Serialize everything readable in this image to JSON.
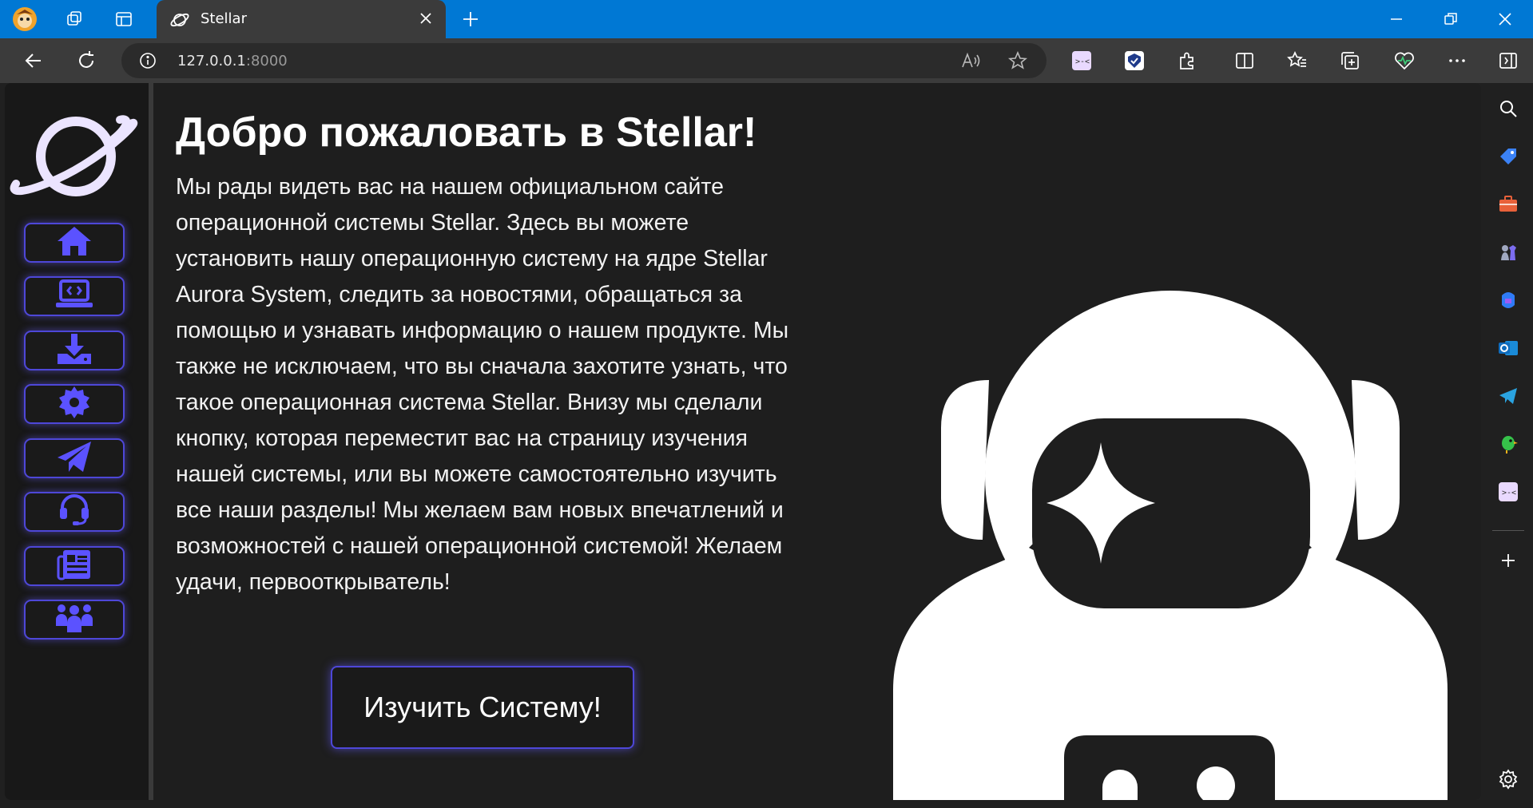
{
  "browser": {
    "tab": {
      "title": "Stellar"
    },
    "address": {
      "host": "127.0.0.1",
      "port": ":8000"
    }
  },
  "page": {
    "title": "Добро пожаловать в Stellar!",
    "intro": "Мы рады видеть вас на нашем официальном сайте операционной системы Stellar. Здесь вы можете установить нашу операционную систему на ядре Stellar Aurora System, следить за новостями, обращаться за помощью и узнавать информацию о нашем продукте. Мы также не исключаем, что вы сначала захотите узнать, что такое операционная система Stellar. Внизу мы сделали кнопку, которая переместит вас на страницу изучения нашей системы, или вы можете самостоятельно изучить все наши разделы! Мы желаем вам новых впечатлений и возможностей с нашей операционной системой! Желаем удачи, первооткрыватель!",
    "cta_label": "Изучить Систему!"
  },
  "nav": {
    "items": [
      {
        "icon": "home-icon"
      },
      {
        "icon": "laptop-code-icon"
      },
      {
        "icon": "download-icon"
      },
      {
        "icon": "gear-icon"
      },
      {
        "icon": "paper-plane-icon"
      },
      {
        "icon": "headset-icon"
      },
      {
        "icon": "newspaper-icon"
      },
      {
        "icon": "people-group-icon"
      }
    ]
  },
  "colors": {
    "accent": "#5b52ff",
    "titlebar": "#0078d4",
    "page_bg": "#1e1e1e"
  }
}
